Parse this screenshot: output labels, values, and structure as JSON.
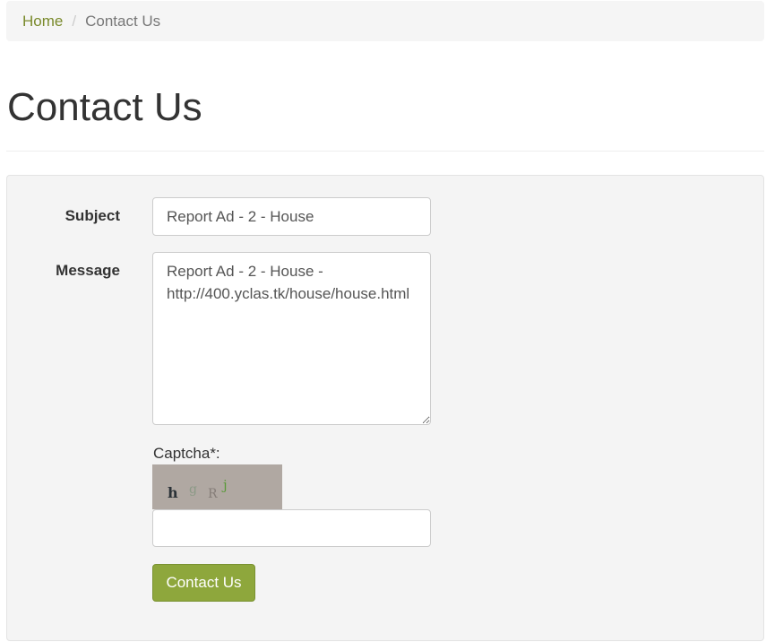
{
  "breadcrumb": {
    "home": "Home",
    "separator": "/",
    "current": "Contact Us"
  },
  "page": {
    "title": "Contact Us"
  },
  "form": {
    "subject_label": "Subject",
    "subject_value": "Report Ad - 2 - House",
    "message_label": "Message",
    "message_value": "Report Ad - 2 - House -\nhttp://400.yclas.tk/house/house.html",
    "captcha_label": "Captcha*:",
    "captcha_chars": [
      "h",
      "g",
      "R",
      "j"
    ],
    "captcha_value": "",
    "submit_label": "Contact Us"
  },
  "colors": {
    "accent": "#8ea73c",
    "link": "#7a8a2c",
    "well_background": "#f4f4f4"
  }
}
